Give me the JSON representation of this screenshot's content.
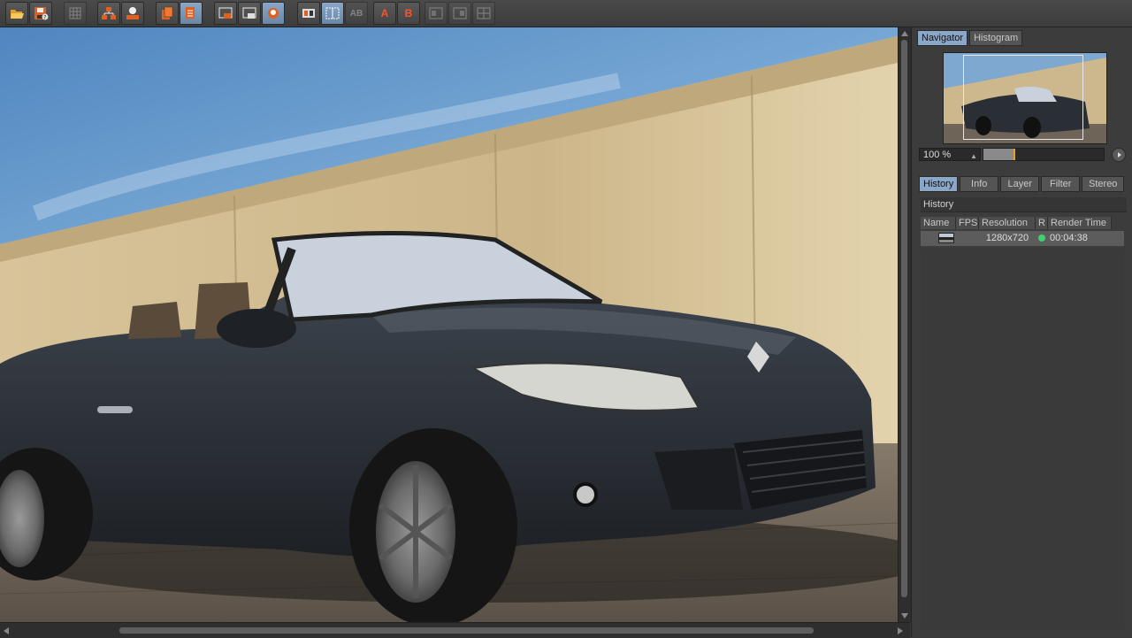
{
  "toolbar": {
    "groups": [
      {
        "buttons": [
          {
            "icon": "folder-open-icon",
            "tooltip_label": ""
          },
          {
            "icon": "save-help-icon",
            "tooltip_label": ""
          }
        ]
      },
      {
        "buttons": [
          {
            "icon": "region-grid-icon",
            "tooltip_label": ""
          }
        ]
      },
      {
        "buttons": [
          {
            "icon": "render-tree-icon",
            "tooltip_label": ""
          },
          {
            "icon": "render-user-icon",
            "tooltip_label": ""
          }
        ]
      },
      {
        "buttons": [
          {
            "icon": "layer-stack-icon",
            "tooltip_label": ""
          },
          {
            "icon": "layer-list-icon",
            "tooltip_label": ""
          }
        ]
      },
      {
        "buttons": [
          {
            "icon": "region-render-icon",
            "tooltip_label": ""
          },
          {
            "icon": "region-save-icon",
            "tooltip_label": ""
          },
          {
            "icon": "region-people-icon",
            "tooltip_label": ""
          }
        ]
      },
      {
        "buttons": [
          {
            "icon": "compare-ab-icon",
            "tooltip_label": "AB"
          },
          {
            "icon": "compare-grid-icon",
            "tooltip_label": ""
          },
          {
            "icon": "compare-split-icon",
            "tooltip_label": "AB"
          }
        ]
      },
      {
        "buttons": [
          {
            "icon": "set-a-icon",
            "tooltip_label": "A"
          },
          {
            "icon": "set-b-icon",
            "tooltip_label": "B"
          }
        ]
      },
      {
        "buttons": [
          {
            "icon": "stereo-left-icon",
            "tooltip_label": ""
          },
          {
            "icon": "stereo-right-icon",
            "tooltip_label": ""
          },
          {
            "icon": "stereo-both-icon",
            "tooltip_label": ""
          }
        ]
      }
    ],
    "letters": {
      "ab1": "AB",
      "ab2": "AB",
      "a": "A",
      "b": "B"
    }
  },
  "navigator_tabs": [
    {
      "label": "Navigator",
      "active": true
    },
    {
      "label": "Histogram",
      "active": false
    }
  ],
  "zoom": {
    "value": "100 %",
    "slider_fraction": 0.26
  },
  "bottom_tabs": [
    {
      "label": "History",
      "active": true
    },
    {
      "label": "Info",
      "active": false
    },
    {
      "label": "Layer",
      "active": false
    },
    {
      "label": "Filter",
      "active": false
    },
    {
      "label": "Stereo",
      "active": false
    }
  ],
  "history": {
    "title": "History",
    "columns": [
      "Name",
      "FPS",
      "Resolution",
      "R",
      "Render Time"
    ],
    "rows": [
      {
        "name": "",
        "fps": "",
        "resolution": "1280x720",
        "status_color": "#40d070",
        "render_time": "00:04:38"
      }
    ]
  },
  "colors": {
    "accent": "#8aa6c8",
    "sky_top": "#5a8fc8",
    "wall": "#cbb58d",
    "car_body": "#2d3238",
    "ground": "#6e6458"
  }
}
